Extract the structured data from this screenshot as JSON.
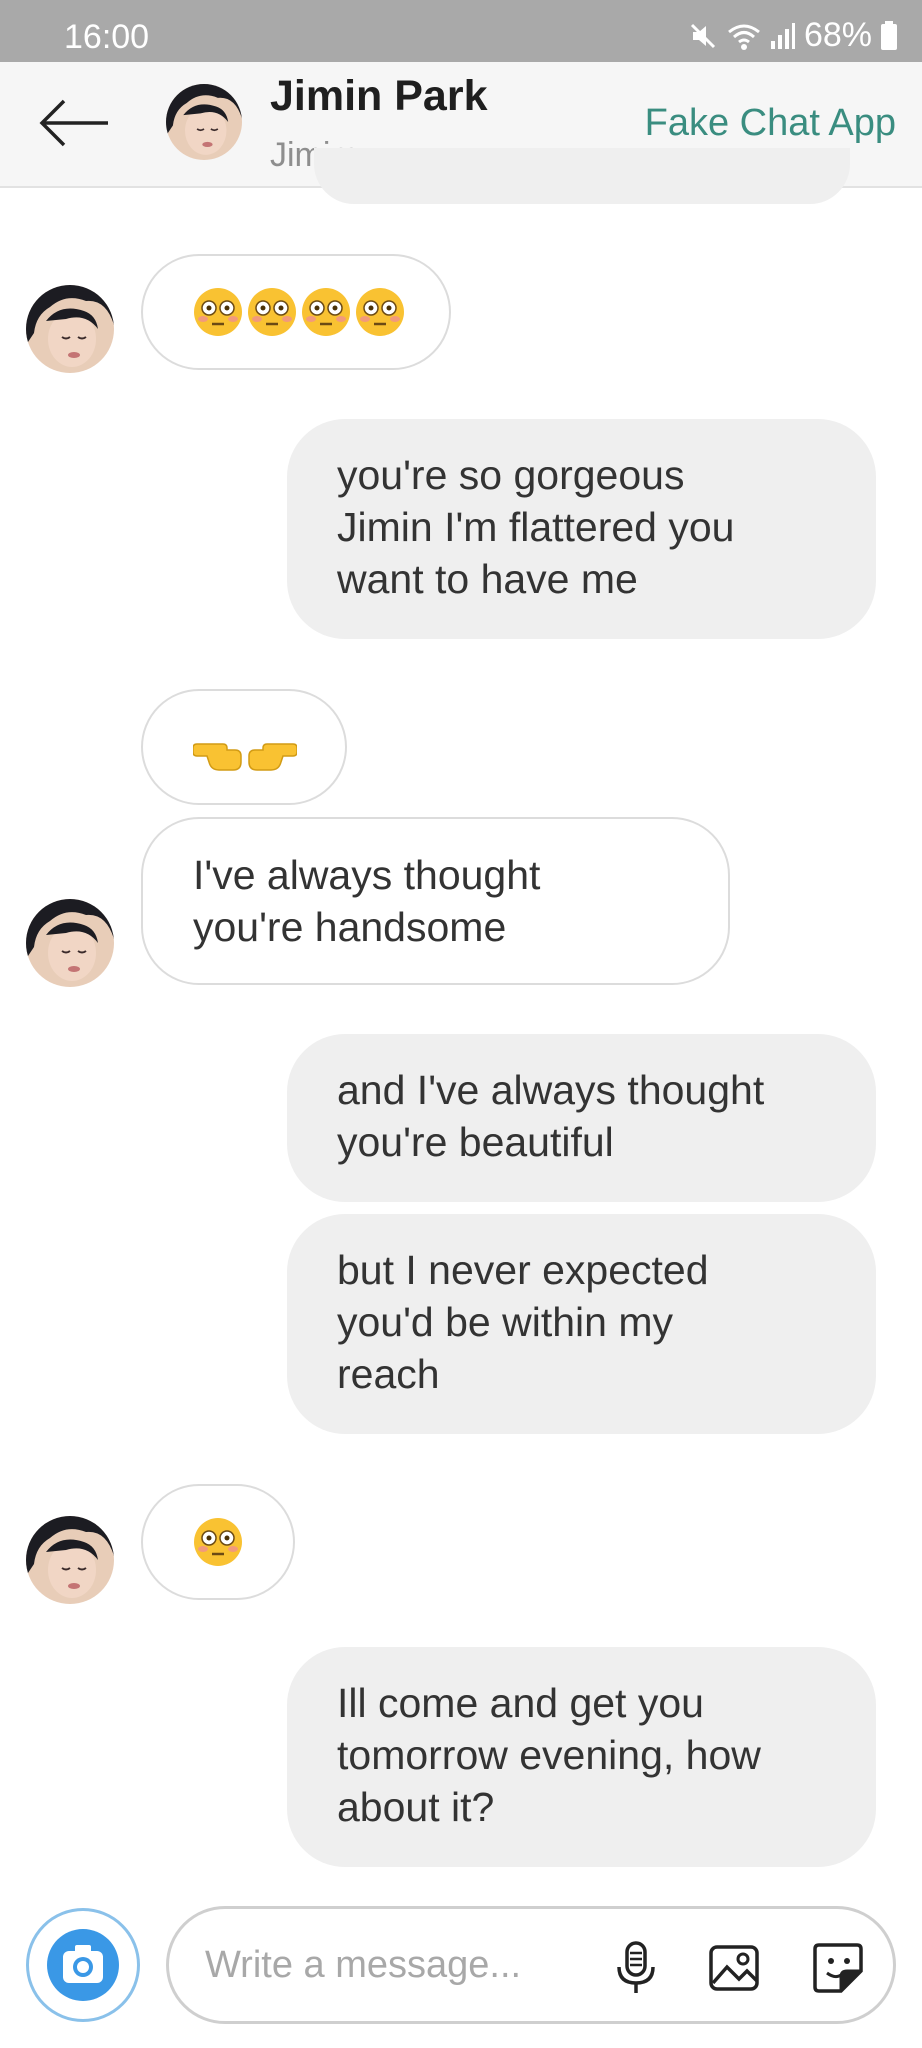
{
  "status_bar": {
    "time": "16:00",
    "battery": "68%"
  },
  "header": {
    "contact_name": "Jimin Park",
    "contact_subtitle": "Jimim",
    "app_name": "Fake Chat App"
  },
  "messages": [
    {
      "side": "in",
      "emoji": [
        "flushed-face",
        "flushed-face",
        "flushed-face",
        "flushed-face"
      ]
    },
    {
      "side": "out",
      "text": "you're so gorgeous\nJimin I'm flattered you\nwant to have me"
    },
    {
      "side": "in",
      "emoji": [
        "pointing-fingers"
      ]
    },
    {
      "side": "in",
      "text": "I've always thought\nyou're handsome"
    },
    {
      "side": "out",
      "text": "and I've always thought\nyou're beautiful"
    },
    {
      "side": "out",
      "text": "but I never expected\nyou'd be within my\nreach"
    },
    {
      "side": "in",
      "emoji": [
        "flushed-face"
      ]
    },
    {
      "side": "out",
      "text": "Ill come and get you\ntomorrow evening, how\nabout it?"
    }
  ],
  "composer": {
    "placeholder": "Write a message...",
    "icons": [
      "camera-icon",
      "microphone-icon",
      "image-icon",
      "sticker-icon"
    ]
  },
  "colors": {
    "status_bar": "#a9a9a9",
    "accent": "#3a8d80",
    "outgoing_bubble": "#efefef",
    "camera": "#3a98e6"
  }
}
